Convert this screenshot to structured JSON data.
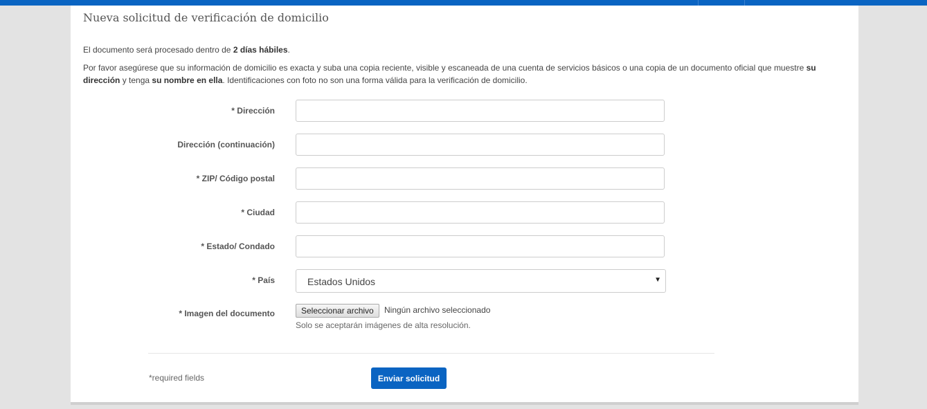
{
  "page": {
    "title": "Nueva solicitud de verificación de domicilio",
    "intro": {
      "pre": "El documento será procesado dentro de ",
      "bold": "2 días hábiles",
      "post": "."
    },
    "instructions": {
      "part1": "Por favor asegúrese que su información de domicilio es exacta y suba una copia reciente, visible y escaneada de una cuenta de servicios básicos o una copia de un documento oficial que muestre ",
      "bold1": "su dirección",
      "part2": " y tenga ",
      "bold2": "su nombre en ella",
      "part3": ". Identificaciones con foto no son una forma válida para la verificación de domicilio."
    }
  },
  "form": {
    "address": {
      "label": "* Dirección",
      "value": ""
    },
    "address2": {
      "label": "Dirección (continuación)",
      "value": ""
    },
    "zip": {
      "label": "* ZIP/ Código postal",
      "value": ""
    },
    "city": {
      "label": "* Ciudad",
      "value": ""
    },
    "state": {
      "label": "* Estado/ Condado",
      "value": ""
    },
    "country": {
      "label": "* País",
      "selected": "Estados Unidos"
    },
    "document": {
      "label": "* Imagen del documento",
      "button": "Seleccionar archivo",
      "status": "Ningún archivo seleccionado",
      "help": "Solo se aceptarán imágenes de alta resolución."
    }
  },
  "footer": {
    "required_note": "*required fields",
    "submit": "Enviar solicitud"
  },
  "colors": {
    "accent": "#0a64c2",
    "background": "#e3e3e3"
  },
  "icons": {
    "select_caret": "caret-down-icon"
  }
}
